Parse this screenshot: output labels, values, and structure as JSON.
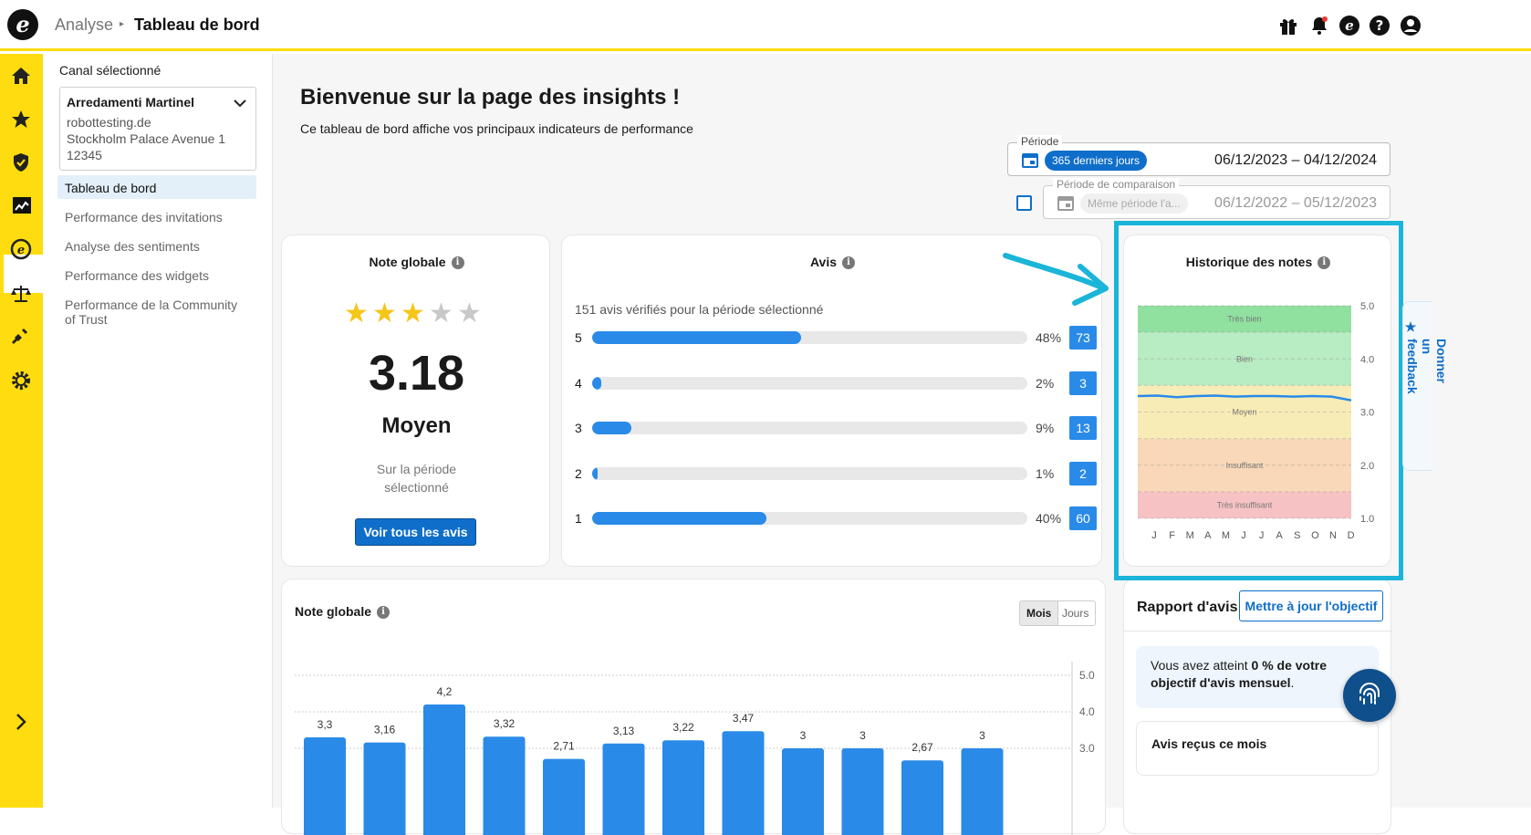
{
  "header": {
    "breadcrumb_parent": "Analyse",
    "breadcrumb_current": "Tableau de bord",
    "logo": "e"
  },
  "sidebar": {
    "channel_label": "Canal sélectionné",
    "channel": {
      "name": "Arredamenti Martinel",
      "line1": "robottesting.de",
      "line2": "Stockholm Palace Avenue 1",
      "line3": "12345"
    },
    "items": [
      {
        "label": "Tableau de bord"
      },
      {
        "label": "Performance des invitations"
      },
      {
        "label": "Analyse des sentiments"
      },
      {
        "label": "Performance des widgets"
      },
      {
        "label": "Performance de la Community"
      },
      {
        "label": "of Trust"
      }
    ]
  },
  "page": {
    "title": "Bienvenue sur la page des insights !",
    "subtitle": "Ce tableau de bord affiche vos principaux indicateurs de performance"
  },
  "period": {
    "label": "Période",
    "chip": "365 derniers jours",
    "range": "06/12/2023 – 04/12/2024"
  },
  "comparison": {
    "label": "Période de comparaison",
    "placeholder": "Même période l'a...",
    "range": "06/12/2022 – 05/12/2023"
  },
  "note_globale": {
    "title": "Note globale",
    "stars_filled": 3,
    "stars_total": 5,
    "score": "3.18",
    "rating": "Moyen",
    "period_text": "Sur la période sélectionné",
    "button": "Voir tous les avis"
  },
  "avis": {
    "title": "Avis",
    "total_text": "151 avis vérifiés pour la période sélectionné",
    "rows": [
      {
        "star": "5",
        "fraction": 0.48,
        "pct": "48%",
        "count": "73"
      },
      {
        "star": "4",
        "fraction": 0.02,
        "pct": "2%",
        "count": "3"
      },
      {
        "star": "3",
        "fraction": 0.09,
        "pct": "9%",
        "count": "13"
      },
      {
        "star": "2",
        "fraction": 0.01,
        "pct": "1%",
        "count": "2"
      },
      {
        "star": "1",
        "fraction": 0.4,
        "pct": "40%",
        "count": "60"
      }
    ]
  },
  "historique": {
    "title": "Historique des notes",
    "bands": [
      "Très bien",
      "Bien",
      "Moyen",
      "Insuffisant",
      "Très insuffisant"
    ],
    "band_colors": [
      "#90e0a0",
      "#b8ecc2",
      "#f8ecb6",
      "#f8d8b8",
      "#f6c2c4"
    ],
    "yticks": [
      "5.0",
      "4.0",
      "3.0",
      "2.0",
      "1.0"
    ],
    "months": [
      "J",
      "F",
      "M",
      "A",
      "M",
      "J",
      "J",
      "A",
      "S",
      "O",
      "N",
      "D"
    ],
    "series": [
      3.3,
      3.31,
      3.28,
      3.3,
      3.31,
      3.29,
      3.3,
      3.3,
      3.29,
      3.3,
      3.29,
      3.22
    ]
  },
  "chart_data": {
    "type": "bar",
    "title": "Note globale",
    "categories": [
      "",
      "",
      "",
      "",
      "",
      "",
      "",
      "",
      "",
      "",
      "",
      ""
    ],
    "values": [
      3.3,
      3.16,
      4.2,
      3.32,
      2.71,
      3.13,
      3.22,
      3.47,
      3,
      3,
      2.67,
      3
    ],
    "value_labels": [
      "3,3",
      "3,16",
      "4,2",
      "3,32",
      "2,71",
      "3,13",
      "3,22",
      "3,47",
      "3",
      "3",
      "2,67",
      "3"
    ],
    "yticks": [
      "5.0",
      "4.0",
      "3.0"
    ],
    "ylim": [
      0,
      5
    ],
    "grid": true,
    "bar_color": "#2a8ae8"
  },
  "bar_toggle": {
    "months": "Mois",
    "days": "Jours"
  },
  "rapport": {
    "title": "Rapport d'avis",
    "button": "Mettre à jour l'objectif",
    "goal_pre": "Vous avez atteint ",
    "goal_bold": "0 % de votre objectif",
    "goal_bold2": "d'avis mensuel",
    "goal_post": ".",
    "received": "Avis reçus ce mois"
  },
  "feedback": {
    "label": "Donner un feedback"
  },
  "colors": {
    "brand_yellow": "#ffdc0f",
    "primary_blue": "#0f6ec9",
    "bar_blue": "#2a8ae8",
    "highlight_cyan": "#1ab5d8",
    "star_gold": "#f5c518"
  }
}
